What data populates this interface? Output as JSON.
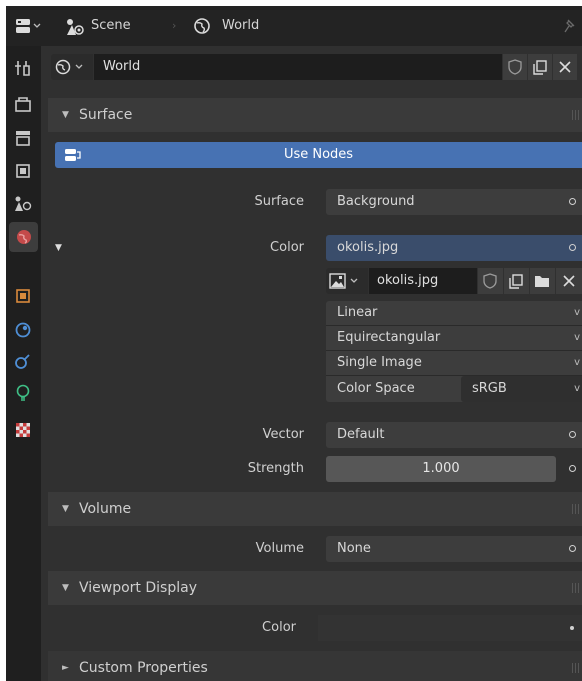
{
  "topbar": {
    "scene_label": "Scene",
    "world_label": "World"
  },
  "world_row": {
    "name": "World"
  },
  "surface_panel": {
    "title": "Surface",
    "use_nodes": "Use Nodes"
  },
  "surface_props": {
    "surface_label": "Surface",
    "surface_value": "Background",
    "color_label": "Color",
    "color_value": "okolis.jpg",
    "image_name": "okolis.jpg",
    "interpolation": "Linear",
    "projection": "Equirectangular",
    "source": "Single Image",
    "colorspace_label": "Color Space",
    "colorspace_value": "sRGB",
    "vector_label": "Vector",
    "vector_value": "Default",
    "strength_label": "Strength",
    "strength_value": "1.000"
  },
  "volume_panel": {
    "title": "Volume",
    "volume_label": "Volume",
    "volume_value": "None"
  },
  "viewport_panel": {
    "title": "Viewport Display",
    "color_label": "Color"
  },
  "custom_panel": {
    "title": "Custom Properties"
  },
  "colors": {
    "accent": "#4772b3",
    "panel": "#303030",
    "field": "#3d3d3d",
    "sidebar": "#1f1f1f"
  }
}
